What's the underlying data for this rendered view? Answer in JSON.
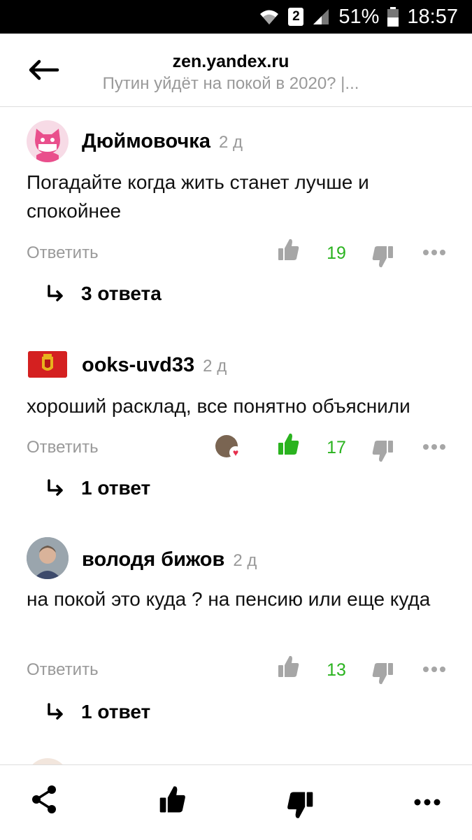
{
  "status_bar": {
    "battery": "51%",
    "time": "18:57",
    "sim": "2"
  },
  "header": {
    "host": "zen.yandex.ru",
    "page_title": "Путин уйдёт на покой в 2020? |..."
  },
  "comments": [
    {
      "author": "Дюймовочка",
      "time": "2 д",
      "text": "Погадайте когда жить станет лучше и спокойнее",
      "reply_label": "Ответить",
      "likes": "19",
      "liked": false,
      "replies_label": "3 ответа"
    },
    {
      "author": "ooks-uvd33",
      "time": "2 д",
      "text": "хороший расклад, все понятно объяснили",
      "reply_label": "Ответить",
      "likes": "17",
      "liked": true,
      "replies_label": "1 ответ"
    },
    {
      "author": "володя бижов",
      "time": "2 д",
      "text": "на покой это куда ? на пенсию или еще куда",
      "reply_label": "Ответить",
      "likes": "13",
      "liked": false,
      "replies_label": "1 ответ"
    }
  ],
  "colors": {
    "accent_green": "#2ab31f",
    "muted": "#999999",
    "icon_gray": "#a6a6a6"
  },
  "bottom_bar": {
    "icons": [
      "share-icon",
      "thumbs-up-icon",
      "thumbs-down-icon",
      "more-icon"
    ]
  }
}
